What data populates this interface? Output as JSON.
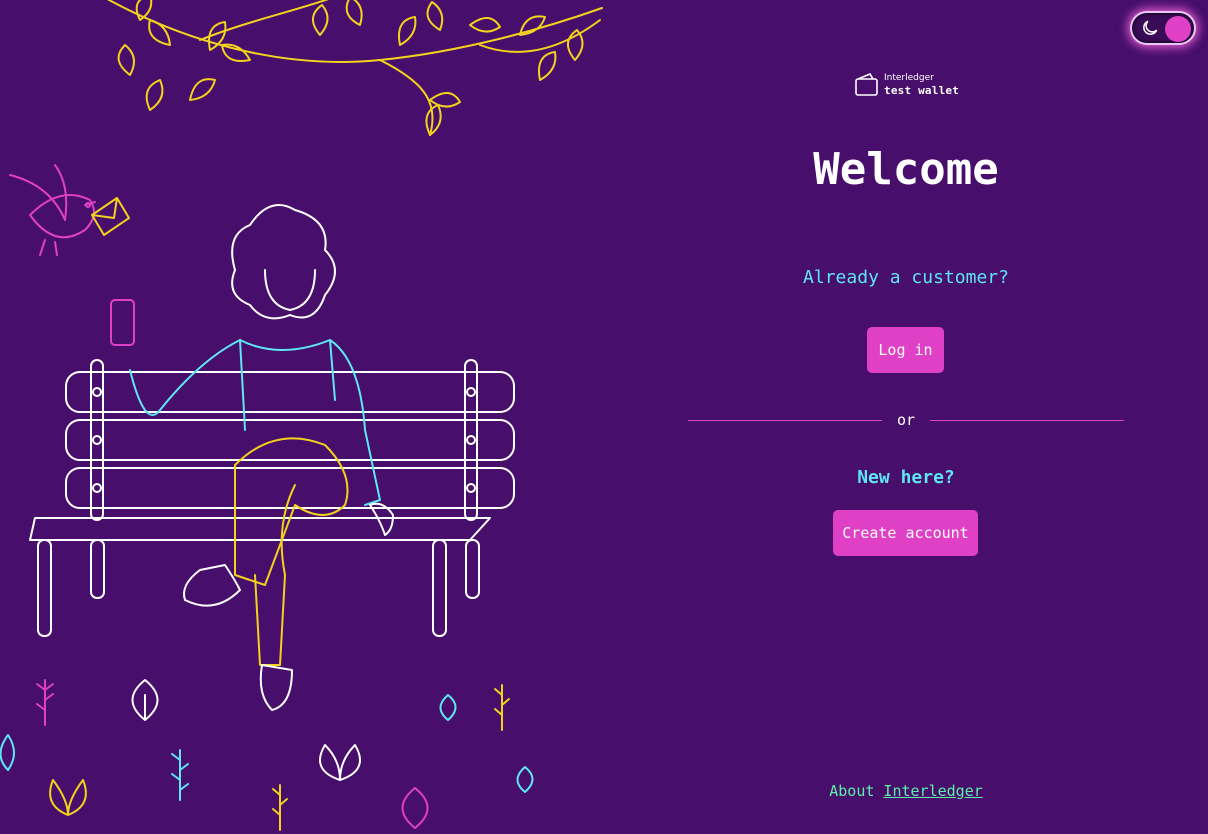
{
  "colors": {
    "background": "#470e6b",
    "accent": "#e040c6",
    "cyan": "#5ee6f5",
    "green": "#5ef0a8",
    "yellow": "#f3d21e"
  },
  "theme_toggle": {
    "icon": "moon-icon",
    "state": "dark"
  },
  "brand": {
    "small": "Interledger",
    "main": "test wallet",
    "icon": "wallet-icon"
  },
  "welcome": {
    "title": "Welcome",
    "existing_prompt": "Already a customer?",
    "login_label": "Log in",
    "divider_text": "or",
    "new_prompt": "New here?",
    "create_label": "Create account"
  },
  "footer": {
    "about": "About",
    "link": "Interledger"
  }
}
